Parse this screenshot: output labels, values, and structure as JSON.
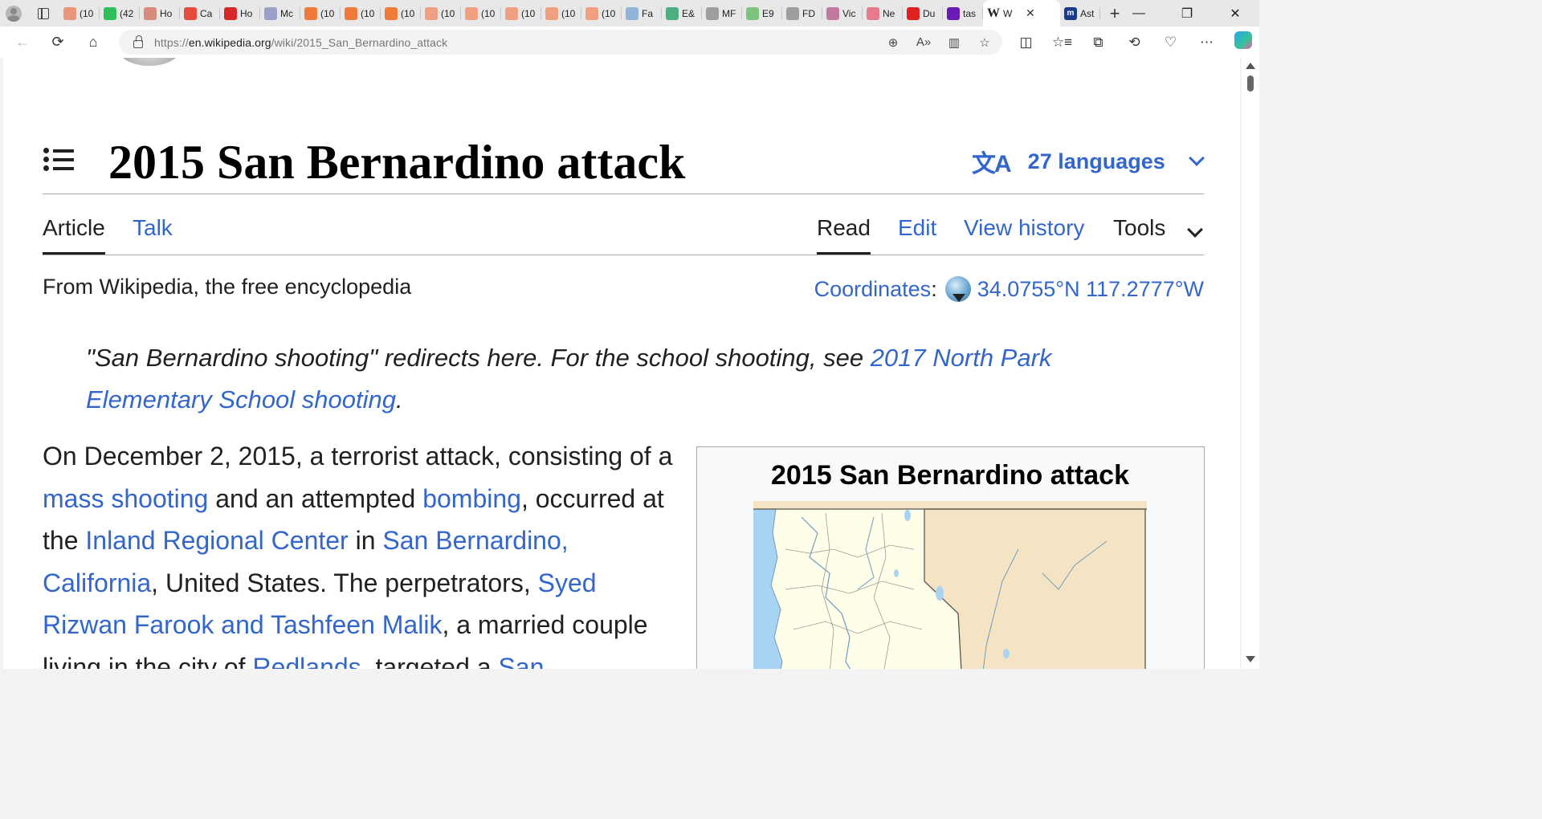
{
  "browser": {
    "tabs": [
      {
        "label": "(10",
        "favicon_color": "#e9967a",
        "icon": "bookmark-icon"
      },
      {
        "label": "(42",
        "favicon_color": "#2fbf5a",
        "icon": "g-icon"
      },
      {
        "label": "Ho",
        "favicon_color": "#d88b7d",
        "icon": "bi-icon"
      },
      {
        "label": "Ca",
        "favicon_color": "#e84a3c",
        "icon": "play-icon"
      },
      {
        "label": "Ho",
        "favicon_color": "#d62828",
        "icon": "alert-icon"
      },
      {
        "label": "Mc",
        "favicon_color": "#9aa0c8",
        "icon": "a-icon"
      },
      {
        "label": "(10",
        "favicon_color": "#f07a3a",
        "icon": "bookmark-icon"
      },
      {
        "label": "(10",
        "favicon_color": "#f07a3a",
        "icon": "bookmark-icon"
      },
      {
        "label": "(10",
        "favicon_color": "#f07a3a",
        "icon": "bookmark-icon"
      },
      {
        "label": "(10",
        "favicon_color": "#f0a080",
        "icon": "bookmark-icon"
      },
      {
        "label": "(10",
        "favicon_color": "#f0a080",
        "icon": "bookmark-icon"
      },
      {
        "label": "(10",
        "favicon_color": "#f0a080",
        "icon": "bookmark-icon"
      },
      {
        "label": "(10",
        "favicon_color": "#f0a080",
        "icon": "bookmark-icon"
      },
      {
        "label": "(10",
        "favicon_color": "#f0a080",
        "icon": "bookmark-icon"
      },
      {
        "label": "Fa",
        "favicon_color": "#8fb4d8",
        "icon": "map-icon"
      },
      {
        "label": "E&",
        "favicon_color": "#4caf80",
        "icon": "power-icon"
      },
      {
        "label": "MF",
        "favicon_color": "#9e9e9e",
        "icon": "doc-icon"
      },
      {
        "label": "E9",
        "favicon_color": "#7dc47d",
        "icon": "play-icon"
      },
      {
        "label": "FD",
        "favicon_color": "#9e9e9e",
        "icon": "doc-icon"
      },
      {
        "label": "Vic",
        "favicon_color": "#c07aa0",
        "icon": "star-icon"
      },
      {
        "label": "Ne",
        "favicon_color": "#e87a8a",
        "icon": "r-icon"
      },
      {
        "label": "Du",
        "favicon_color": "#e02020",
        "icon": "youtube-icon"
      },
      {
        "label": "tas",
        "favicon_color": "#6a1bb3",
        "icon": "yahoo-icon"
      }
    ],
    "active_tab": {
      "label": "W",
      "close": "✕"
    },
    "after_tab": {
      "label": "Ast",
      "favicon_color": "#1a3a8a",
      "icon": "m-icon"
    },
    "new_tab": "+",
    "window_controls": [
      "—",
      "❐",
      "✕"
    ],
    "url_prefix": "https://",
    "url_host": "en.wikipedia.org",
    "url_path": "/wiki/2015_San_Bernardino_attack",
    "toolbar_icons": [
      "←",
      "⟳",
      "⌂"
    ],
    "omnibox_icons": [
      "⊕",
      "A»",
      "▥",
      "☆"
    ],
    "right_icons": [
      "◫",
      "☆≡",
      "⧉",
      "⟲",
      "♡"
    ],
    "more_label": "⋯"
  },
  "page": {
    "title": "2015 San Bernardino attack",
    "languages_label": "27 languages",
    "languages_glyph": "文A",
    "tabs": {
      "article": "Article",
      "talk": "Talk",
      "read": "Read",
      "edit": "Edit",
      "view_history": "View history",
      "tools": "Tools"
    },
    "tagline": "From Wikipedia, the free encyclopedia",
    "coordinates_label": "Coordinates",
    "coordinates_value": "34.0755°N 117.2777°W",
    "hatnote": {
      "prefix": "\"San Bernardino shooting\" redirects here. For the school shooting, see ",
      "link": "2017 North Park Elementary School shooting",
      "suffix": "."
    },
    "lead": {
      "t1": "On December 2, 2015, a terrorist attack, consisting of a ",
      "l1": "mass shooting",
      "t2": " and an attempted ",
      "l2": "bombing",
      "t3": ", occurred at the ",
      "l3": "Inland Regional Center",
      "t4": " in ",
      "l4": "San Bernardino, California",
      "t5": ", United States. The perpetrators, ",
      "l5": "Syed Rizwan Farook and Tashfeen Malik",
      "t6": ", a married couple living in the city of ",
      "l6": "Redlands",
      "t7": ", targeted a ",
      "l7": "San"
    },
    "infobox_title": "2015 San Bernardino attack"
  },
  "colors": {
    "link": "#3366cc",
    "text": "#202122",
    "map_land": "#fefee9",
    "map_nevada": "#f5e4c3",
    "map_water": "#a9d3f2"
  }
}
